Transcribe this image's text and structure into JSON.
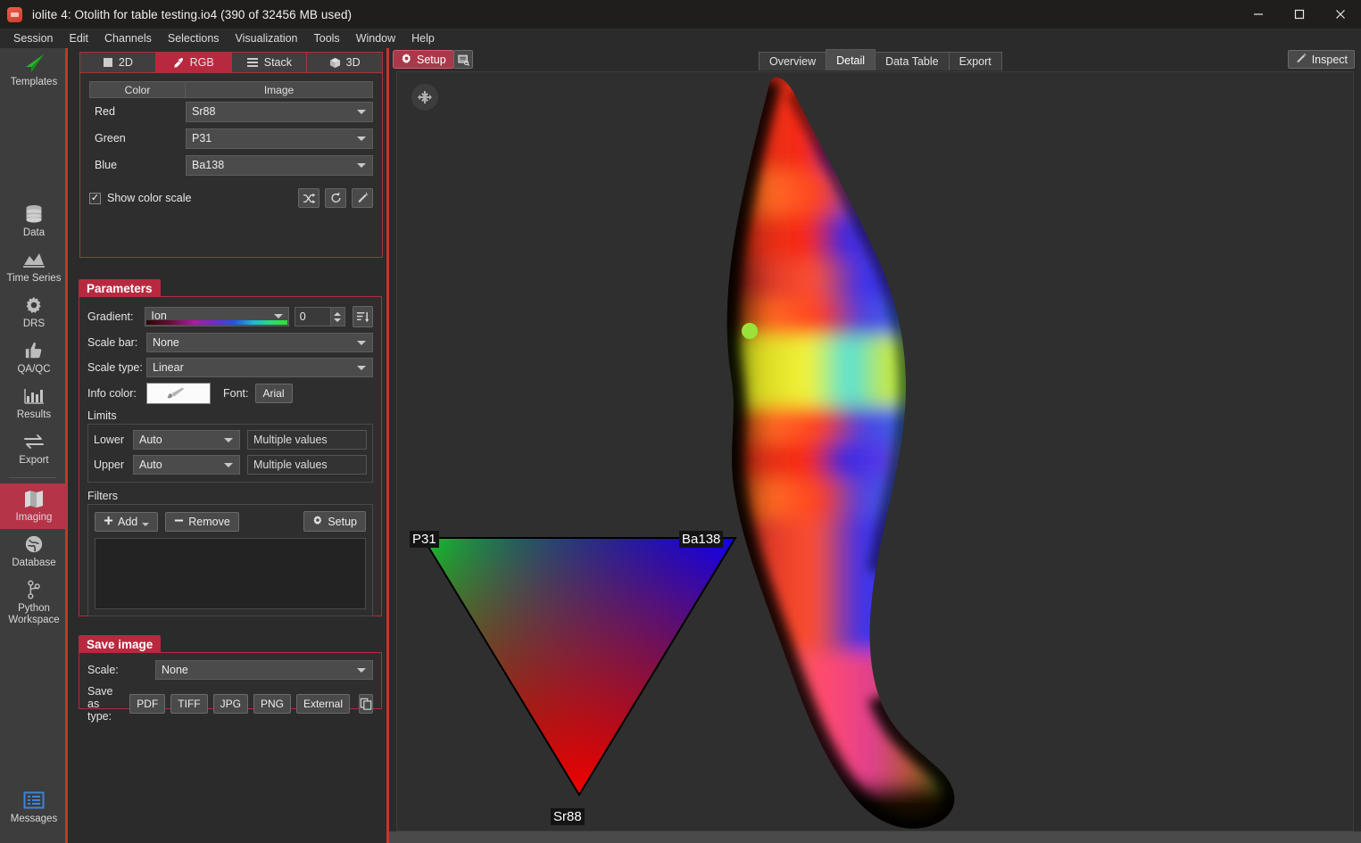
{
  "window": {
    "title": "iolite 4: Otolith for table testing.io4 (390 of 32456 MB used)",
    "app_icon": "iolite-icon",
    "minimize": "minimize-icon",
    "maximize": "maximize-icon",
    "close": "close-icon"
  },
  "menubar": {
    "items": [
      {
        "label": "Session"
      },
      {
        "label": "Edit"
      },
      {
        "label": "Channels"
      },
      {
        "label": "Selections"
      },
      {
        "label": "Visualization"
      },
      {
        "label": "Tools"
      },
      {
        "label": "Window"
      },
      {
        "label": "Help"
      }
    ]
  },
  "rail": {
    "items": [
      {
        "label": "Templates",
        "icon": "paper-plane-icon",
        "active": false
      },
      {
        "label": "Data",
        "icon": "database-icon",
        "active": false
      },
      {
        "label": "Time Series",
        "icon": "time-series-icon",
        "active": false
      },
      {
        "label": "DRS",
        "icon": "gear-icon",
        "active": false
      },
      {
        "label": "QA/QC",
        "icon": "thumbs-up-icon",
        "active": false
      },
      {
        "label": "Results",
        "icon": "bar-chart-icon",
        "active": false
      },
      {
        "label": "Export",
        "icon": "exchange-arrows-icon",
        "active": false
      },
      {
        "label": "Imaging",
        "icon": "map-icon",
        "active": true
      },
      {
        "label": "Database",
        "icon": "globe-icon",
        "active": false
      },
      {
        "label": "Python Workspace",
        "icon": "branch-icon",
        "active": false
      }
    ],
    "bottom": {
      "label": "Messages",
      "icon": "messages-icon"
    }
  },
  "mode_tabs": [
    {
      "label": "2D",
      "icon": "square-icon",
      "active": false
    },
    {
      "label": "RGB",
      "icon": "eyedropper-icon",
      "active": true
    },
    {
      "label": "Stack",
      "icon": "layers-icon",
      "active": false
    },
    {
      "label": "3D",
      "icon": "cube-icon",
      "active": false
    }
  ],
  "rgb_table": {
    "headers": [
      "Color",
      "Image"
    ],
    "rows": [
      {
        "color": "Red",
        "image": "Sr88"
      },
      {
        "color": "Green",
        "image": "P31"
      },
      {
        "color": "Blue",
        "image": "Ba138"
      }
    ],
    "show_color_scale": {
      "label": "Show color scale",
      "checked": true,
      "check_glyph": "✓"
    },
    "buttons": [
      {
        "icon": "shuffle-icon",
        "name": "shuffle-channels-button"
      },
      {
        "icon": "reset-icon",
        "name": "reset-channels-button"
      },
      {
        "icon": "wand-icon",
        "name": "auto-adjust-button"
      }
    ]
  },
  "parameters": {
    "title": "Parameters",
    "gradient": {
      "label": "Gradient:",
      "value": "Ion",
      "spin_value": "0",
      "sort_icon": "sort-descending-icon"
    },
    "scale_bar": {
      "label": "Scale bar:",
      "value": "None"
    },
    "scale_type": {
      "label": "Scale type:",
      "value": "Linear"
    },
    "info_color": {
      "label": "Info color:",
      "swatch": "#ffffff",
      "brush_icon": "brush-icon"
    },
    "font": {
      "label": "Font:",
      "value": "Arial"
    },
    "limits": {
      "title": "Limits",
      "lower": {
        "label": "Lower",
        "mode": "Auto",
        "value": "Multiple values"
      },
      "upper": {
        "label": "Upper",
        "mode": "Auto",
        "value": "Multiple values"
      }
    },
    "filters": {
      "title": "Filters",
      "add": "Add",
      "remove": "Remove",
      "setup": "Setup",
      "list_items": []
    }
  },
  "save_image": {
    "title": "Save image",
    "scale": {
      "label": "Scale:",
      "value": "None"
    },
    "save_as_type": {
      "label": "Save as type:",
      "options": [
        "PDF",
        "TIFF",
        "JPG",
        "PNG",
        "External"
      ],
      "copy_icon": "copy-icon"
    }
  },
  "right_pane": {
    "setup_button": {
      "label": "Setup",
      "icon": "gear-icon"
    },
    "tool_icon": "image-tool-icon",
    "tabs": [
      {
        "label": "Overview",
        "active": false
      },
      {
        "label": "Detail",
        "active": true
      },
      {
        "label": "Data Table",
        "active": false
      },
      {
        "label": "Export",
        "active": false
      }
    ],
    "inspect_button": {
      "label": "Inspect",
      "icon": "wand-icon"
    },
    "fit_button": {
      "icon": "fit-to-view-icon"
    }
  },
  "rgb_triangle": {
    "vertices": [
      {
        "label": "P31",
        "position": "top-left",
        "color": "#00ff00"
      },
      {
        "label": "Ba138",
        "position": "top-right",
        "color": "#0000ff"
      },
      {
        "label": "Sr88",
        "position": "bottom",
        "color": "#ff0000"
      }
    ]
  }
}
